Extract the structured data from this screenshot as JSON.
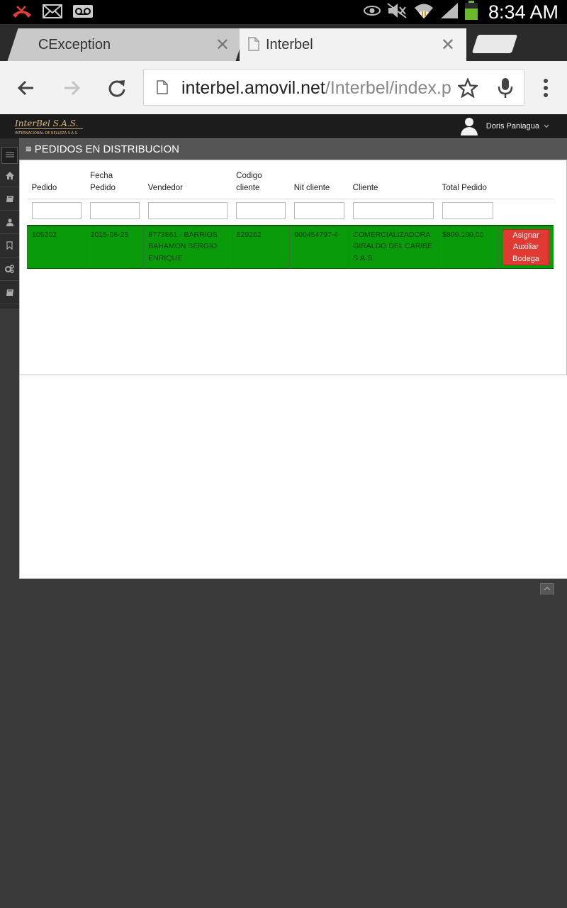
{
  "status_bar": {
    "time": "8:34 AM",
    "left_icons": [
      "missed-call-icon",
      "mail-icon",
      "voicemail-icon"
    ],
    "right_icons": [
      "eye-icon",
      "mute-icon",
      "wifi-icon",
      "signal-icon",
      "battery-icon"
    ]
  },
  "browser": {
    "tabs": [
      {
        "title": "CException",
        "active": false
      },
      {
        "title": "Interbel",
        "active": true
      }
    ],
    "url_host": "interbel.amovil.net",
    "url_path": "/Interbel/index.p"
  },
  "app": {
    "logo_text": "InterBel S.A.S.",
    "logo_subtext": "INTERNACIONAL DE BELLEZA S.A.S.",
    "user_name": "Doris Paniagua"
  },
  "sidebar": {
    "items": [
      "menu-icon",
      "home-icon",
      "book-icon",
      "user-icon",
      "bookmark-icon",
      "cogs-icon",
      "book-icon"
    ]
  },
  "panel": {
    "title": "PEDIDOS EN DISTRIBUCION"
  },
  "table": {
    "columns": [
      {
        "line1": "",
        "line2": "Pedido"
      },
      {
        "line1": "Fecha",
        "line2": "Pedido"
      },
      {
        "line1": "",
        "line2": "Vendedor"
      },
      {
        "line1": "Codigo",
        "line2": "cliente"
      },
      {
        "line1": "",
        "line2": "Nit cliente"
      },
      {
        "line1": "",
        "line2": "Cliente"
      },
      {
        "line1": "",
        "line2": "Total Pedido"
      }
    ],
    "rows": [
      {
        "pedido": "105202",
        "fecha": "2015-06-25",
        "vendedor": "8773861 - BARRIOS BAHAMON SERGIO ENRIQUE",
        "codigo": "629262",
        "nit": "900454797-4",
        "cliente": "COMERCIALIZADORA GIRALDO DEL CARIBE S.A.S.",
        "total": "$809.100,00",
        "action": "Asignar Auxiliar Bodega"
      }
    ],
    "row_color": "#0a9b0a",
    "action_color": "#e03a33"
  }
}
